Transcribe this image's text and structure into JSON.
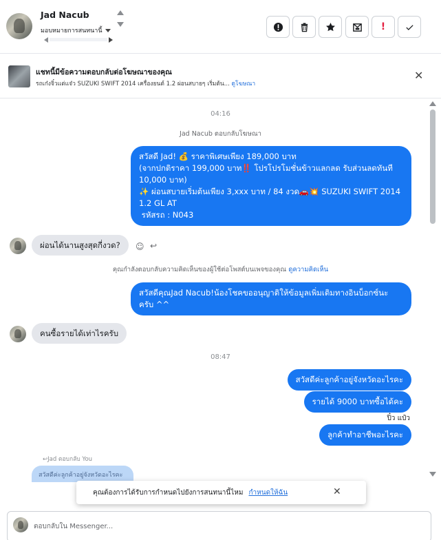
{
  "header": {
    "contact_name": "Jad Nacub",
    "assign_label": "มอบหมายการสนทนานี้",
    "actions": [
      {
        "name": "spam-button",
        "glyph": "!"
      },
      {
        "name": "delete-button",
        "glyph": "trash"
      },
      {
        "name": "star-button",
        "glyph": "star"
      },
      {
        "name": "mark-unread-button",
        "glyph": "envelope"
      },
      {
        "name": "follow-up-button",
        "glyph": "!"
      },
      {
        "name": "done-button",
        "glyph": "check"
      }
    ]
  },
  "banner": {
    "title": "แชทนี้มีข้อความตอบกลับต่อโฆษณาของคุณ",
    "subtitle": "รถเก๋งจิ๋วแต่แจ๋ว SUZUKI SWIFT 2014 เครื่องยนต์ 1.2 ผ่อนสบายๆ เริ่มต้น...",
    "link": "ดูโฆษณา"
  },
  "chat": {
    "time1": "04:16",
    "ad_reply_note": "Jad Nacub ตอบกลับโฆษณา",
    "msg_out_1_lines": [
      "สวัสดี Jad! 💰 ราคาพิเศษเพียง 189,000 บาท",
      "(จากปกติราคา 199,000 บาท‼️ โปรโปรโมชั่นข้าวแลกลด รับส่วนลดทันที",
      "10,000 บาท)",
      "✨ ผ่อนสบายเริ่มต้นเพียง 3,xxx บาท / 84 งวด🚗💥 SUZUKI SWIFT 2014",
      "1.2 GL AT",
      " รหัสรถ : N043"
    ],
    "msg_in_1": "ผ่อนได้นานสูงสุดกี่งวด?",
    "comment_note": "คุณกำลังตอบกลับความคิดเห็นของผู้ใช้ต่อโพสต์บนเพจของคุณ",
    "comment_link": "ดูความคิดเห็น",
    "msg_out_2_lines": [
      "สวัสดีคุณJad Nacub!น้องโชคขออนุญาติให้ข้อมูลเพิ่มเติมทางอินบ็อกซ์นะ",
      "ครับ ^^"
    ],
    "msg_in_2": "คนซื้อรายได้เท่าไรครับ",
    "time2": "08:47",
    "msg_out_3": "สวัสดีค่ะลูกค้าอยู่จังหวัดอะไรคะ",
    "msg_out_4": "รายได้ 9000 บาทซื้อได้คะ",
    "seen_label": "ปิ๋ว แป๋ว",
    "msg_out_5": "ลูกค้าทำอาชีพอะไรคะ",
    "reply_hint": "↩Jad ตอบกลับ You",
    "quoted": "สวัสดีค่ะลูกค้าอยู่จังหวัดอะไรคะ"
  },
  "toast": {
    "text": "คุณต้องการได้รับการกำหนดไปยังการสนทนานี้ไหม",
    "link": "กำหนดให้ฉัน"
  },
  "composer": {
    "placeholder": "ตอบกลับใน Messenger..."
  }
}
